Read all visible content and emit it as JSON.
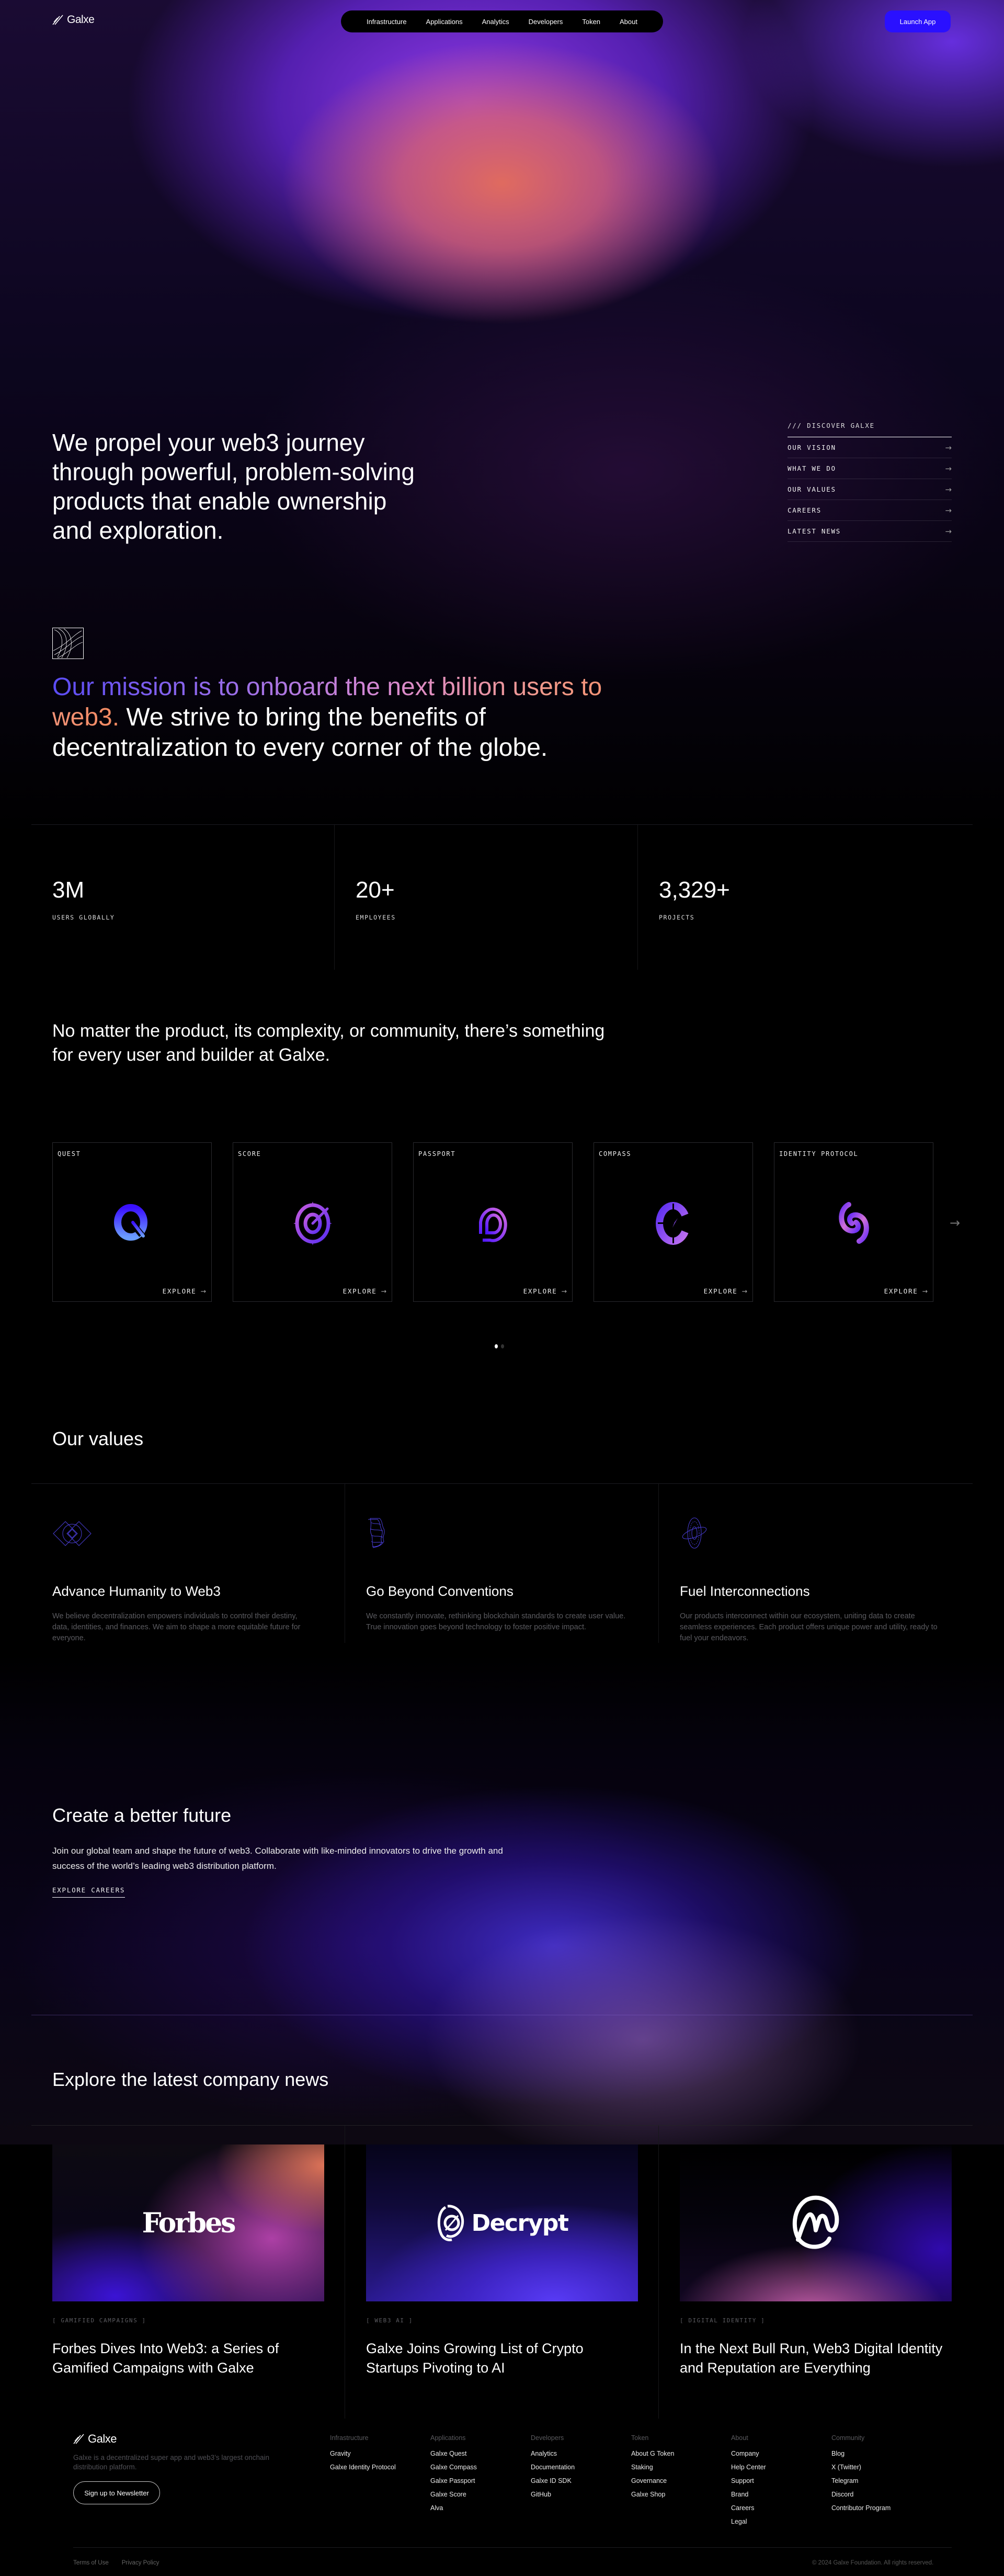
{
  "brand": {
    "name": "Galxe",
    "accent": "#2a10ff"
  },
  "nav": {
    "items": [
      "Infrastructure",
      "Applications",
      "Analytics",
      "Developers",
      "Token",
      "About"
    ],
    "launch_label": "Launch App"
  },
  "hero": {
    "title": "We propel your web3 journey through powerful, problem-solving products that enable ownership and exploration.",
    "discover": {
      "heading": "/// DISCOVER GALXE",
      "items": [
        "OUR VISION",
        "WHAT WE DO",
        "OUR VALUES",
        "CAREERS",
        "LATEST NEWS"
      ]
    }
  },
  "mission": {
    "highlight": "Our mission is to onboard the next billion users to web3.",
    "rest": " We strive to bring the benefits of decentralization to every corner of the globe."
  },
  "stats": [
    {
      "value": "3M",
      "label": "USERS GLOBALLY"
    },
    {
      "value": "20+",
      "label": "EMPLOYEES"
    },
    {
      "value": "3,329+",
      "label": "PROJECTS"
    }
  ],
  "products": {
    "heading": "No matter the product, its complexity, or community, there’s something for every user and builder at Galxe.",
    "explore_label": "EXPLORE",
    "items": [
      {
        "label": "QUEST",
        "icon": "quest-logo-icon"
      },
      {
        "label": "SCORE",
        "icon": "score-logo-icon"
      },
      {
        "label": "PASSPORT",
        "icon": "passport-logo-icon"
      },
      {
        "label": "COMPASS",
        "icon": "compass-logo-icon"
      },
      {
        "label": "IDENTITY PROTOCOL",
        "icon": "identity-protocol-logo-icon"
      }
    ],
    "pagination": {
      "pages": 2,
      "current": 1
    }
  },
  "values": {
    "heading": "Our values",
    "items": [
      {
        "title": "Advance Humanity to Web3",
        "desc": "We believe decentralization empowers individuals to control their destiny, data, identities, and finances. We aim to shape a more equitable future for everyone."
      },
      {
        "title": "Go Beyond Conventions",
        "desc": "We constantly innovate, rethinking blockchain standards to create user value. True innovation goes beyond technology to foster positive impact."
      },
      {
        "title": "Fuel Interconnections",
        "desc": "Our products interconnect within our ecosystem, uniting data to create seamless experiences. Each product offers unique power and utility, ready to fuel your endeavors."
      }
    ]
  },
  "careers": {
    "title": "Create a better future",
    "text": "Join our global team and shape the future of web3. Collaborate with like-minded innovators to drive the growth and success of the world’s leading web3 distribution platform.",
    "link": "EXPLORE CAREERS"
  },
  "news": {
    "heading": "Explore the latest company news",
    "items": [
      {
        "logo": "Forbes",
        "tag": "[ GAMIFIED CAMPAIGNS ]",
        "title": "Forbes Dives Into Web3: a Series of Gamified Campaigns with Galxe"
      },
      {
        "logo": "Decrypt",
        "tag": "[ WEB3 AI ]",
        "title": "Galxe Joins Growing List of Crypto Startups Pivoting to AI"
      },
      {
        "logo": "CoinMarketCap",
        "tag": "[ DIGITAL IDENTITY ]",
        "title": "In the Next Bull Run, Web3 Digital Identity and Reputation are Everything"
      }
    ]
  },
  "footer": {
    "description": "Galxe is a decentralized super app and web3’s largest onchain distribution platform.",
    "newsletter_label": "Sign up to Newsletter",
    "columns": [
      {
        "heading": "Infrastructure",
        "links": [
          "Gravity",
          "Galxe Identity Protocol"
        ]
      },
      {
        "heading": "Applications",
        "links": [
          "Galxe Quest",
          "Galxe Compass",
          "Galxe Passport",
          "Galxe Score",
          "Alva"
        ]
      },
      {
        "heading": "Developers",
        "links": [
          "Analytics",
          "Documentation",
          "Galxe ID SDK",
          "GitHub"
        ]
      },
      {
        "heading": "Token",
        "links": [
          "About G Token",
          "Staking",
          "Governance",
          "Galxe Shop"
        ]
      },
      {
        "heading": "About",
        "links": [
          "Company",
          "Help Center",
          "Support",
          "Brand",
          "Careers",
          "Legal"
        ]
      },
      {
        "heading": "Community",
        "links": [
          "Blog",
          "X (Twitter)",
          "Telegram",
          "Discord",
          "Contributor Program"
        ]
      }
    ],
    "legal": [
      "Terms of Use",
      "Privacy Policy"
    ],
    "copyright": "© 2024 Galxe Foundation. All rights reserved."
  }
}
